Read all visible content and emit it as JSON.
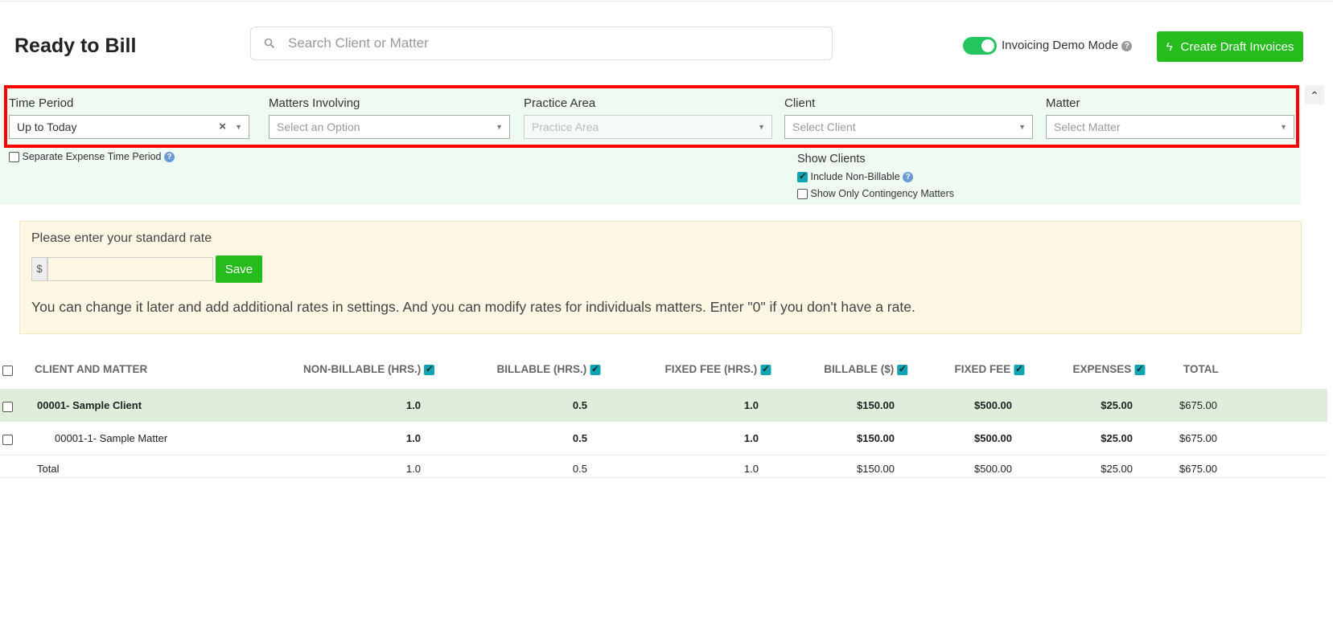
{
  "header": {
    "title": "Ready to Bill",
    "search_placeholder": "Search Client or Matter",
    "demo_mode_label": "Invoicing Demo Mode",
    "demo_mode_on": true,
    "create_button": "Create Draft Invoices"
  },
  "filters": {
    "time_period": {
      "label": "Time Period",
      "value": "Up to Today"
    },
    "matters_involving": {
      "label": "Matters Involving",
      "placeholder": "Select an Option"
    },
    "practice_area": {
      "label": "Practice Area",
      "placeholder": "Practice Area"
    },
    "client": {
      "label": "Client",
      "placeholder": "Select Client"
    },
    "matter": {
      "label": "Matter",
      "placeholder": "Select Matter"
    },
    "separate_expense": "Separate Expense Time Period",
    "show_clients": "Show Clients",
    "include_non_billable": "Include Non-Billable",
    "only_contingency": "Show Only Contingency Matters"
  },
  "rate": {
    "prompt": "Please enter your standard rate",
    "currency": "$",
    "save": "Save",
    "message": "You can change it later and add additional rates in settings. And you can modify rates for individuals matters. Enter \"0\" if you don't have a rate."
  },
  "table": {
    "headers": [
      "CLIENT AND MATTER",
      "NON-BILLABLE (HRS.)",
      "BILLABLE (HRS.)",
      "FIXED FEE (HRS.)",
      "BILLABLE ($)",
      "FIXED FEE",
      "EXPENSES",
      "TOTAL"
    ],
    "rows": [
      {
        "name": "00001- Sample Client",
        "values": [
          "1.0",
          "0.5",
          "1.0",
          "$150.00",
          "$500.00",
          "$25.00",
          "$675.00"
        ]
      },
      {
        "name": "00001-1- Sample Matter",
        "values": [
          "1.0",
          "0.5",
          "1.0",
          "$150.00",
          "$500.00",
          "$25.00",
          "$675.00"
        ]
      },
      {
        "name": "Total",
        "values": [
          "1.0",
          "0.5",
          "1.0",
          "$150.00",
          "$500.00",
          "$25.00",
          "$675.00"
        ]
      }
    ]
  },
  "colors": {
    "accent": "#26bc1e",
    "teal": "#0fa4b4",
    "panel": "#effbf2",
    "client_row": "#dfeedb",
    "rate_box": "#fdf7e3"
  }
}
